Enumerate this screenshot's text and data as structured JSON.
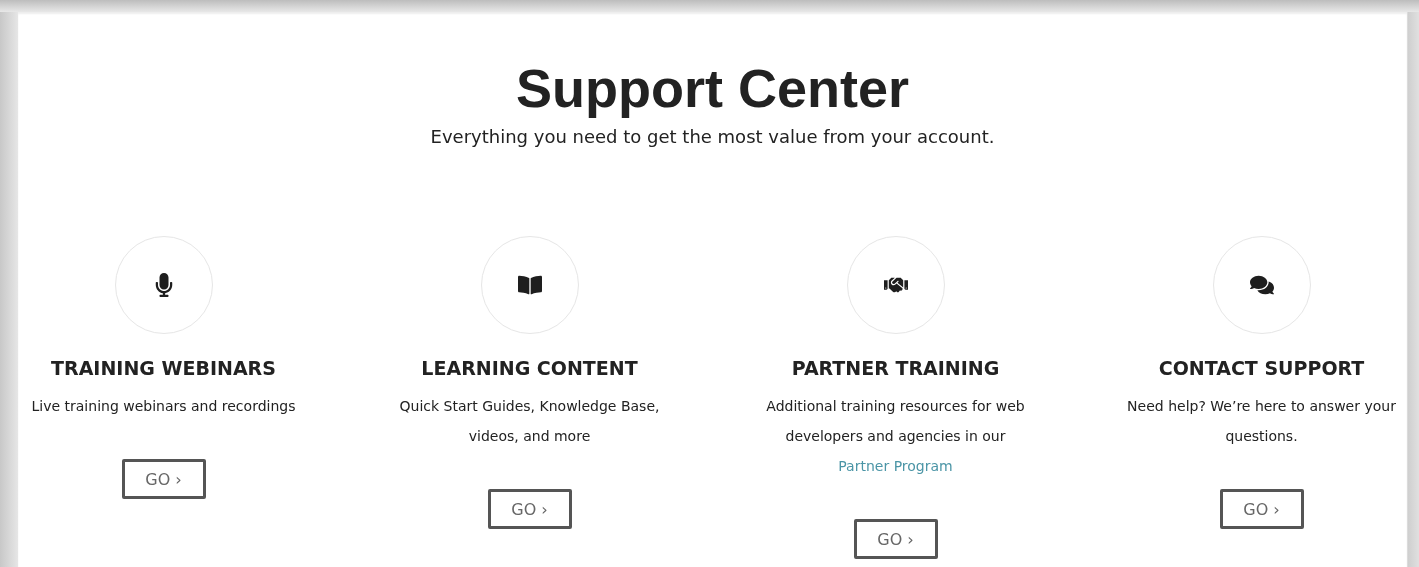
{
  "title": "Support Center",
  "subtitle": "Everything you need to get the most value from your account.",
  "cards": [
    {
      "heading": "TRAINING WEBINARS",
      "description": "Live training webinars and recordings",
      "button": "GO ›"
    },
    {
      "heading": "LEARNING CONTENT",
      "description": "Quick Start Guides, Knowledge Base, videos, and more",
      "button": "GO ›"
    },
    {
      "heading": "PARTNER TRAINING",
      "description": "Additional training resources for web developers and agencies in our",
      "link": "Partner Program",
      "button": "GO ›"
    },
    {
      "heading": "CONTACT SUPPORT",
      "description": "Need help? We’re here to answer your questions.",
      "button": "GO ›"
    }
  ]
}
